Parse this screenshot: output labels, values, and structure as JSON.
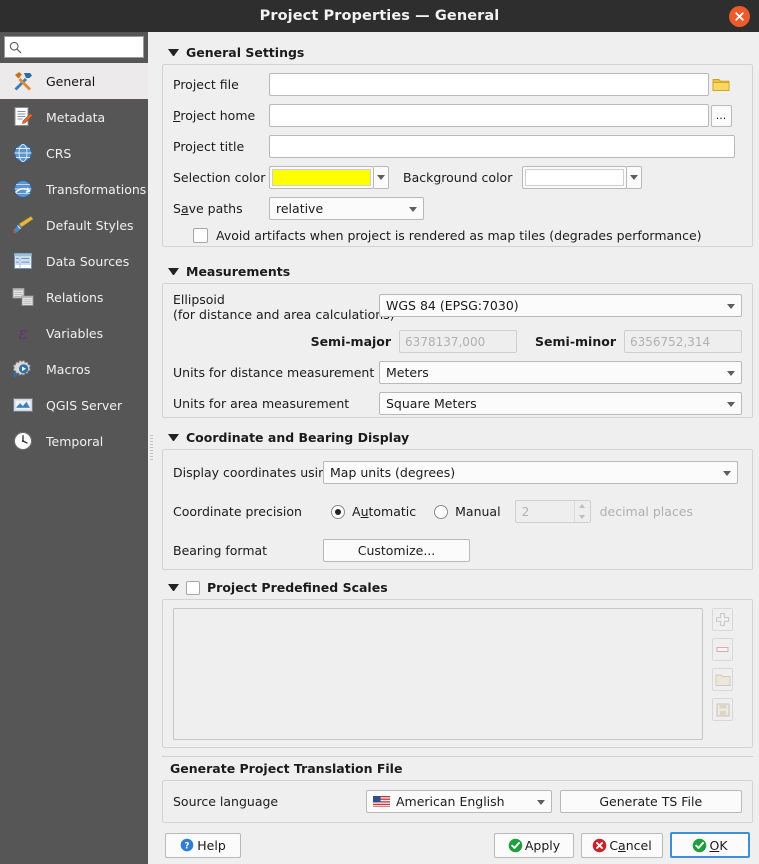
{
  "window": {
    "title": "Project Properties — General",
    "close_icon": "close-circle-icon"
  },
  "sidebar": {
    "search": {
      "placeholder": "",
      "value": "",
      "icon": "search-icon"
    },
    "items": [
      {
        "label": "General",
        "icon": "hammer-wrench-icon",
        "selected": true
      },
      {
        "label": "Metadata",
        "icon": "document-pencil-icon",
        "selected": false
      },
      {
        "label": "CRS",
        "icon": "globe-grid-icon",
        "selected": false
      },
      {
        "label": "Transformations",
        "icon": "globe-arrow-icon",
        "selected": false
      },
      {
        "label": "Default Styles",
        "icon": "paintbrush-icon",
        "selected": false
      },
      {
        "label": "Data Sources",
        "icon": "table-icon",
        "selected": false
      },
      {
        "label": "Relations",
        "icon": "two-tables-icon",
        "selected": false
      },
      {
        "label": "Variables",
        "icon": "epsilon-icon",
        "selected": false
      },
      {
        "label": "Macros",
        "icon": "gear-play-icon",
        "selected": false
      },
      {
        "label": "QGIS Server",
        "icon": "map-image-icon",
        "selected": false
      },
      {
        "label": "Temporal",
        "icon": "clock-icon",
        "selected": false
      }
    ]
  },
  "general_settings": {
    "group_title": "General Settings",
    "project_file": {
      "label": "Project file",
      "value": "",
      "browse_icon": "folder-icon"
    },
    "project_home": {
      "label": "Project home",
      "value": "",
      "browse_label": "..."
    },
    "project_title": {
      "label": "Project title",
      "value": ""
    },
    "selection_color": {
      "label": "Selection color",
      "value": "#ffff00"
    },
    "background_color": {
      "label": "Background color",
      "value": "#ffffff"
    },
    "save_paths": {
      "label": "Save paths",
      "value": "relative"
    },
    "avoid_artifacts": {
      "label": "Avoid artifacts when project is rendered as map tiles (degrades performance)",
      "checked": false
    }
  },
  "measurements": {
    "group_title": "Measurements",
    "ellipsoid": {
      "label_line1": "Ellipsoid",
      "label_line2": "(for distance and area calculations)",
      "value": "WGS 84 (EPSG:7030)"
    },
    "semi_major": {
      "label": "Semi-major",
      "value": "6378137,000",
      "enabled": false
    },
    "semi_minor": {
      "label": "Semi-minor",
      "value": "6356752,314",
      "enabled": false
    },
    "distance_units": {
      "label": "Units for distance measurement",
      "value": "Meters"
    },
    "area_units": {
      "label": "Units for area measurement",
      "value": "Square Meters"
    }
  },
  "coordinate_display": {
    "group_title": "Coordinate and Bearing Display",
    "display_coordinates": {
      "label": "Display coordinates using",
      "value": "Map units (degrees)"
    },
    "precision": {
      "label": "Coordinate precision",
      "automatic_label": "Automatic",
      "manual_label": "Manual",
      "selected": "Automatic",
      "manual_value": "2",
      "suffix": "decimal places"
    },
    "bearing_format": {
      "label": "Bearing format",
      "button_label": "Customize..."
    }
  },
  "predefined_scales": {
    "group_title": "Project Predefined Scales",
    "checked": false,
    "items": [],
    "tools": [
      {
        "name": "add-scale-button",
        "icon": "plus-icon"
      },
      {
        "name": "remove-scale-button",
        "icon": "minus-icon"
      },
      {
        "name": "open-scales-button",
        "icon": "folder-icon"
      },
      {
        "name": "save-scales-button",
        "icon": "floppy-disk-icon"
      }
    ]
  },
  "translation": {
    "group_title": "Generate Project Translation File",
    "source_language": {
      "label": "Source language",
      "value": "American English",
      "flag": "us-flag-icon"
    },
    "generate_button": "Generate TS File"
  },
  "buttons": {
    "help": {
      "label": "Help",
      "icon": "help-circle-icon"
    },
    "apply": {
      "label": "Apply",
      "icon": "check-circle-icon"
    },
    "cancel": {
      "label": "Cancel",
      "icon": "cancel-circle-icon"
    },
    "ok": {
      "label": "OK",
      "icon": "check-circle-icon",
      "default": true
    }
  },
  "colors": {
    "titlebar_bg": "#2e2e2e",
    "sidebar_bg": "#565656",
    "panel_bg": "#efefef",
    "accent_blue": "#3e8fd6",
    "close_orange": "#ec5b2b",
    "green": "#1f9e3e",
    "red": "#c8242b"
  }
}
